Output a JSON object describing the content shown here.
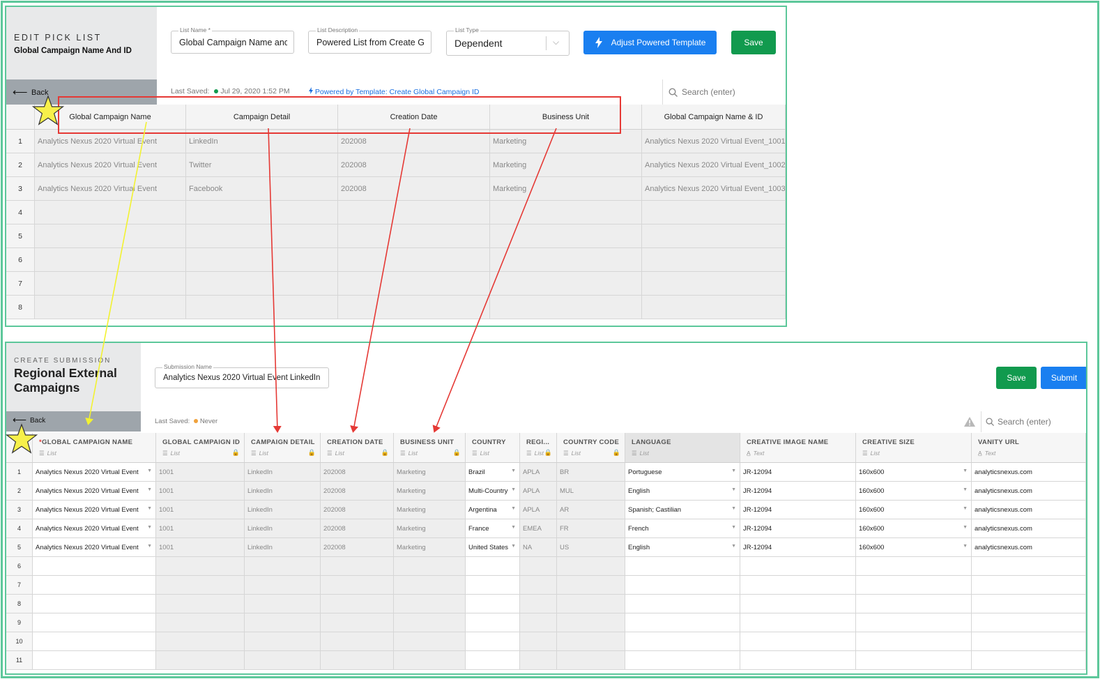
{
  "edit_pick_list": {
    "header_title": "EDIT PICK LIST",
    "list_title": "Global Campaign Name And ID",
    "list_name_label": "List Name *",
    "list_name_value": "Global Campaign Name anc",
    "list_description_label": "List Description",
    "list_description_value": "Powered List from Create G",
    "list_type_label": "List Type",
    "list_type_value": "Dependent",
    "adjust_button_label": "Adjust Powered Template",
    "save_button_label": "Save",
    "back_label": "Back",
    "last_saved": "Last Saved:",
    "last_saved_value": "Jul 29, 2020 1:52 PM",
    "powered_link": "Powered by Template: Create Global Campaign ID",
    "search_placeholder": "Search (enter)",
    "columns": [
      "Global Campaign Name",
      "Campaign Detail",
      "Creation Date",
      "Business Unit",
      "Global Campaign Name & ID"
    ],
    "row_numbers": [
      "1",
      "2",
      "3",
      "4",
      "5",
      "6",
      "7",
      "8"
    ],
    "rows": [
      [
        "Analytics Nexus 2020 Virtual Event",
        "LinkedIn",
        "202008",
        "Marketing",
        "Analytics Nexus 2020 Virtual Event_1001"
      ],
      [
        "Analytics Nexus 2020 Virtual Event",
        "Twitter",
        "202008",
        "Marketing",
        "Analytics Nexus 2020 Virtual Event_1002"
      ],
      [
        "Analytics Nexus 2020 Virtual Event",
        "Facebook",
        "202008",
        "Marketing",
        "Analytics Nexus 2020 Virtual Event_1003"
      ]
    ]
  },
  "create_submission": {
    "header_title": "CREATE SUBMISSION",
    "title": "Regional External Campaigns",
    "submission_name_label": "Submission Name",
    "submission_name_value": "Analytics Nexus 2020 Virtual Event LinkedIn",
    "save_button_label": "Save",
    "submit_button_label": "Submit",
    "back_label": "Back",
    "last_saved": "Last Saved:",
    "last_saved_value": "Never",
    "search_placeholder": "Search (enter)",
    "columns": [
      {
        "name": "GLOBAL CAMPAIGN NAME",
        "required": "*",
        "type": "List"
      },
      {
        "name": "GLOBAL CAMPAIGN ID",
        "type": "List"
      },
      {
        "name": "CAMPAIGN DETAIL",
        "type": "List"
      },
      {
        "name": "CREATION DATE",
        "type": "List"
      },
      {
        "name": "BUSINESS UNIT",
        "type": "List"
      },
      {
        "name": "COUNTRY",
        "type": "List"
      },
      {
        "name": "REGI...",
        "type": "List"
      },
      {
        "name": "COUNTRY CODE",
        "type": "List"
      },
      {
        "name": "LANGUAGE",
        "type": "List"
      },
      {
        "name": "CREATIVE IMAGE NAME",
        "type": "Text"
      },
      {
        "name": "CREATIVE SIZE",
        "type": "List"
      },
      {
        "name": "VANITY URL",
        "type": "Text"
      }
    ],
    "row_numbers": [
      "1",
      "2",
      "3",
      "4",
      "5",
      "6",
      "7",
      "8",
      "9",
      "10",
      "11"
    ],
    "rows": [
      [
        "Analytics Nexus 2020 Virtual Event",
        "1001",
        "LinkedIn",
        "202008",
        "Marketing",
        "Brazil",
        "APLA",
        "BR",
        "Portuguese",
        "JR-12094",
        "160x600",
        "analyticsnexus.com"
      ],
      [
        "Analytics Nexus 2020 Virtual Event",
        "1001",
        "LinkedIn",
        "202008",
        "Marketing",
        "Multi-Country",
        "APLA",
        "MUL",
        "English",
        "JR-12094",
        "160x600",
        "analyticsnexus.com"
      ],
      [
        "Analytics Nexus 2020 Virtual Event",
        "1001",
        "LinkedIn",
        "202008",
        "Marketing",
        "Argentina",
        "APLA",
        "AR",
        "Spanish; Castilian",
        "JR-12094",
        "160x600",
        "analyticsnexus.com"
      ],
      [
        "Analytics Nexus 2020 Virtual Event",
        "1001",
        "LinkedIn",
        "202008",
        "Marketing",
        "France",
        "EMEA",
        "FR",
        "French",
        "JR-12094",
        "160x600",
        "analyticsnexus.com"
      ],
      [
        "Analytics Nexus 2020 Virtual Event",
        "1001",
        "LinkedIn",
        "202008",
        "Marketing",
        "United States",
        "NA",
        "US",
        "English",
        "JR-12094",
        "160x600",
        "analyticsnexus.com"
      ]
    ]
  },
  "colors": {
    "frame_green": "#5cc79a",
    "annotation_red": "#e53935",
    "annotation_yellow": "#f2f230",
    "star_fill": "#f7f04a",
    "button_blue": "#1a7ff0",
    "button_green": "#119a4e"
  }
}
